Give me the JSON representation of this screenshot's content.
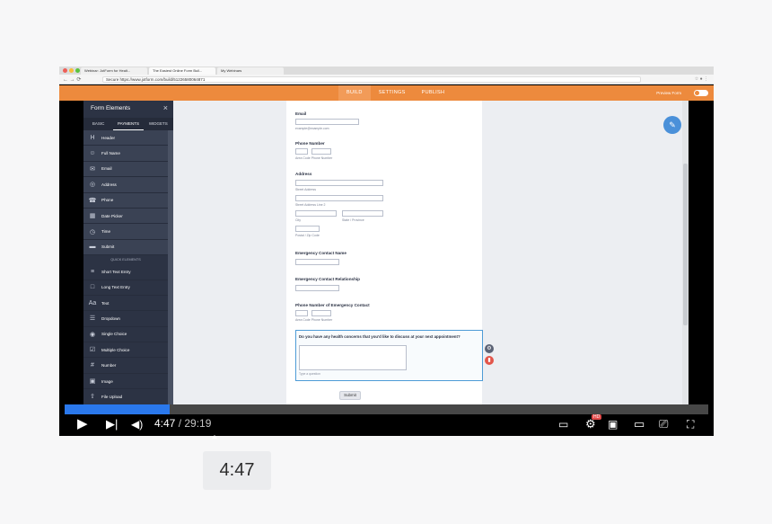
{
  "browser": {
    "tabs": [
      "Webinar: JotForm for Healt...",
      "The Easiest Online Form Buil...",
      "My Webinars"
    ],
    "url": "Secure  https://www.jotform.com/build/51226580064871"
  },
  "builder": {
    "nav_tabs": [
      "BUILD",
      "SETTINGS",
      "PUBLISH"
    ],
    "preview_label": "Preview Form"
  },
  "sidebar": {
    "title": "Form Elements",
    "tabs": [
      "BASIC",
      "PAYMENTS",
      "WIDGETS"
    ],
    "basic_items": [
      {
        "label": "Header",
        "icon": "H"
      },
      {
        "label": "Full Name",
        "icon": "☺"
      },
      {
        "label": "Email",
        "icon": "✉"
      },
      {
        "label": "Address",
        "icon": "◎"
      },
      {
        "label": "Phone",
        "icon": "☎"
      },
      {
        "label": "Date Picker",
        "icon": "▦"
      },
      {
        "label": "Time",
        "icon": "◷"
      },
      {
        "label": "Submit",
        "icon": "▬"
      }
    ],
    "quick_title": "QUICK ELEMENTS",
    "quick_items": [
      {
        "label": "Short Text Entry",
        "icon": "≡"
      },
      {
        "label": "Long Text Entry",
        "icon": "□"
      },
      {
        "label": "Text",
        "icon": "Aa"
      },
      {
        "label": "Dropdown",
        "icon": "☰"
      },
      {
        "label": "Single Choice",
        "icon": "◉"
      },
      {
        "label": "Multiple Choice",
        "icon": "☑"
      },
      {
        "label": "Number",
        "icon": "#"
      },
      {
        "label": "Image",
        "icon": "▣"
      },
      {
        "label": "File Upload",
        "icon": "⇧"
      }
    ]
  },
  "form": {
    "email_label": "Email",
    "email_sub": "example@example.com",
    "phone_label": "Phone Number",
    "phone_sub": "Area Code   Phone Number",
    "address_label": "Address",
    "street_sub": "Street Address",
    "street2_sub": "Street Address Line 2",
    "city_sub": "City",
    "state_sub": "State / Province",
    "postal_sub": "Postal / Zip Code",
    "ec_name_label": "Emergency Contact Name",
    "ec_rel_label": "Emergency Contact Relationship",
    "ec_phone_label": "Phone Number of Emergency Contact",
    "ec_phone_sub": "Area Code   Phone Number",
    "question": "Do you have any health concerns that you'd like to discuss at your next appointment?",
    "question_hint": "Type a question",
    "submit_label": "Submit"
  },
  "player": {
    "current_time": "4:47",
    "duration": "/ 29:19",
    "progress": 0.163,
    "tooltip_time": "4:47"
  }
}
